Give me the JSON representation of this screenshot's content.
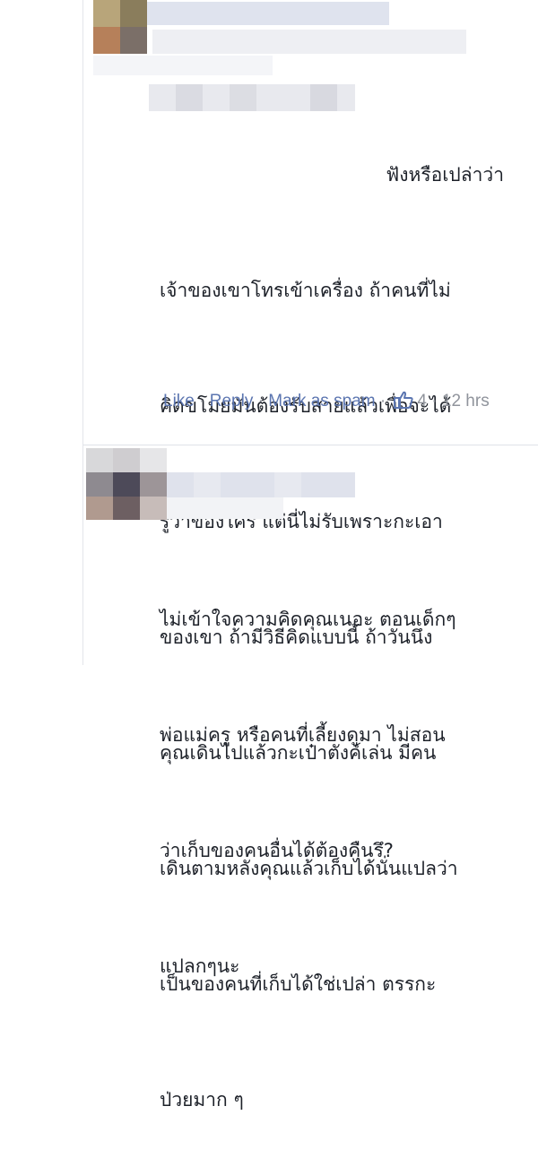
{
  "comment1": {
    "lead_text": "ฟังหรือเปล่าว่า",
    "lines": [
      "เจ้าของเขาโทรเข้าเครื่อง ถ้าคนที่ไม่",
      "คิดขโมยมันต้องรับสายแล้วเพื่อจะได้",
      "รู้ว่าของใคร แต่นี่ไม่รับเพราะกะเอา",
      "ของเขา ถ้ามีวิธีคิดแบบนี้ ถ้าวันนึง",
      "คุณเดินไปแล้วกะเป๋าตังค์เล่น มีคน",
      "เดินตามหลังคุณแล้วเก็บได้นั่นแปลว่า",
      "เป็นของคนที่เก็บได้ใช่เปล่า ตรรกะ",
      "ป่วยมาก ๆ"
    ],
    "actions": {
      "like": "Like",
      "reply": "Reply",
      "spam": "Mark as spam",
      "like_count": "4",
      "time": "12 hrs"
    }
  },
  "comment2": {
    "lines": [
      "ไม่เข้าใจความคิดคุณเนอะ ตอนเด็กๆ",
      "พ่อแม่ครู หรือคนที่เลี้ยงดูมา ไม่สอน",
      "ว่าเก็บของคนอื่นได้ต้องคืนรึ?",
      "แปลกๆนะ"
    ]
  },
  "icons": {
    "like": "thumbs-up-icon"
  },
  "colors": {
    "link": "#5b75b0",
    "meta": "#90949c",
    "text": "#1d2129"
  }
}
